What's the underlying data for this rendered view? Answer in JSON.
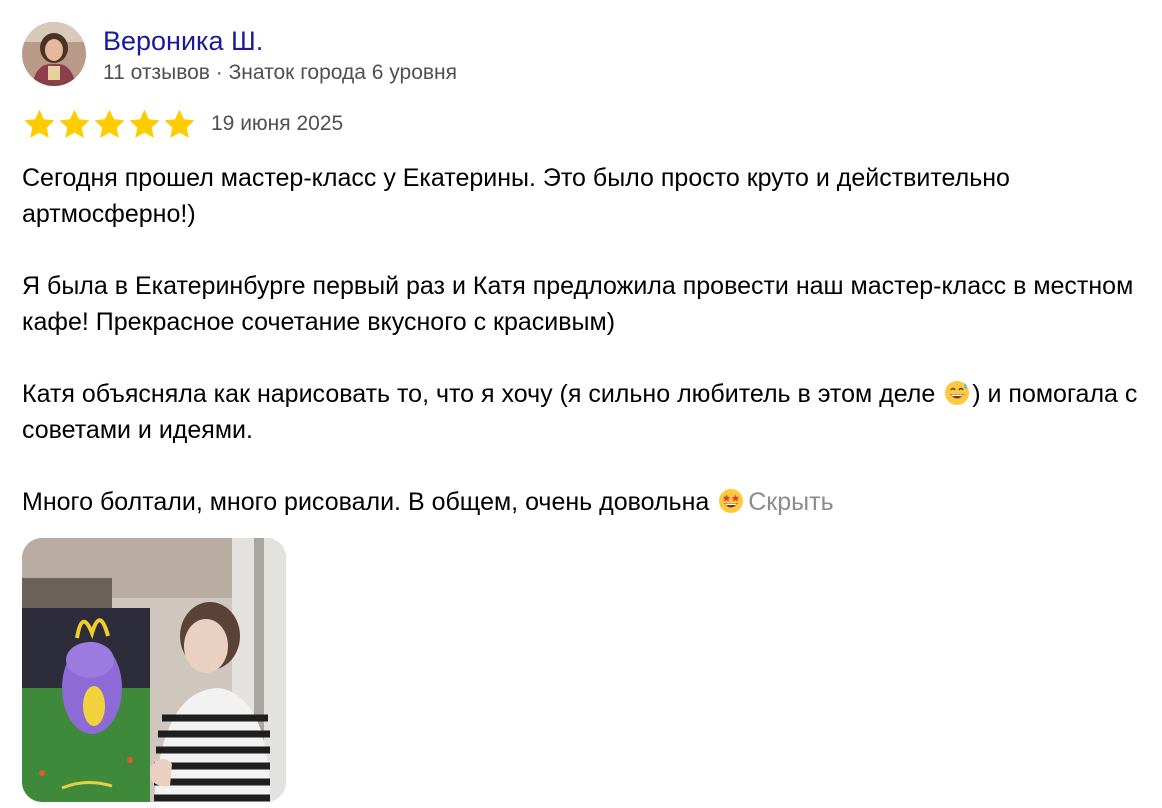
{
  "author": {
    "name": "Вероника Ш.",
    "meta": "11 отзывов · Знаток города 6 уровня"
  },
  "rating": {
    "value": 5,
    "max": 5,
    "color": "#ffcc00"
  },
  "date": "19 июня 2025",
  "paragraphs": [
    "Сегодня прошел мастер-класс у Екатерины. Это было просто круто и действительно артмосферно!)",
    "Я была в Екатеринбурге первый раз и Катя предложила провести наш мастер-класс в местном кафе! Прекрасное сочетание вкусного с красивым)",
    "Катя объясняла как нарисовать то, что я хочу (я сильно любитель в этом деле",
    "Много болтали, много рисовали. В общем, очень довольна"
  ],
  "para3_after_emoji": ") и помогала с советами и идеями.",
  "emojis": {
    "para3": "grinning-sweat-emoji",
    "para4": "star-struck-emoji"
  },
  "hide_label": "Скрыть",
  "colors": {
    "author_link": "#1a1a9a",
    "meta": "#505050",
    "hide_link": "#8c8c8c"
  }
}
